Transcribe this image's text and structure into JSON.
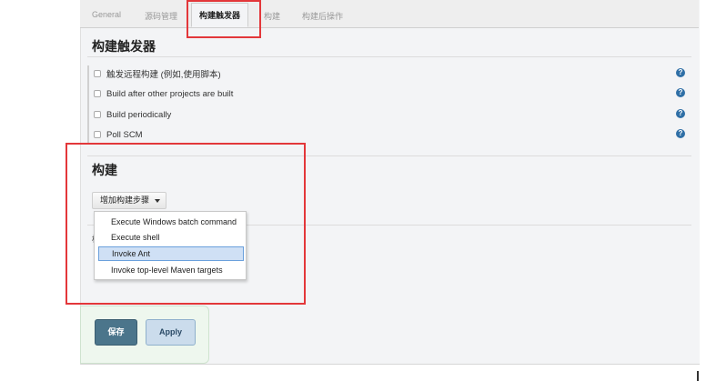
{
  "tabs": [
    {
      "label": "General"
    },
    {
      "label": "源码管理"
    },
    {
      "label": "构建触发器"
    },
    {
      "label": "构建"
    },
    {
      "label": "构建后操作"
    }
  ],
  "triggers": {
    "title": "构建触发器",
    "options": [
      {
        "label": "触发远程构建 (例如,使用脚本)"
      },
      {
        "label": "Build after other projects are built"
      },
      {
        "label": "Build periodically"
      },
      {
        "label": "Poll SCM"
      }
    ],
    "help_glyph": "?"
  },
  "build": {
    "title": "构建",
    "add_step_label": "增加构建步骤",
    "menu_items": [
      {
        "label": "Execute Windows batch command"
      },
      {
        "label": "Execute shell"
      },
      {
        "label": "Invoke Ant"
      },
      {
        "label": "Invoke top-level Maven targets"
      }
    ],
    "hidden_fragment": "构"
  },
  "actions": {
    "save_label": "保存",
    "apply_label": "Apply"
  },
  "colors": {
    "highlight_border": "#e3373a",
    "save_button": "#4b758b",
    "apply_button": "#cbdcec",
    "help_icon": "#2f6fa6"
  }
}
